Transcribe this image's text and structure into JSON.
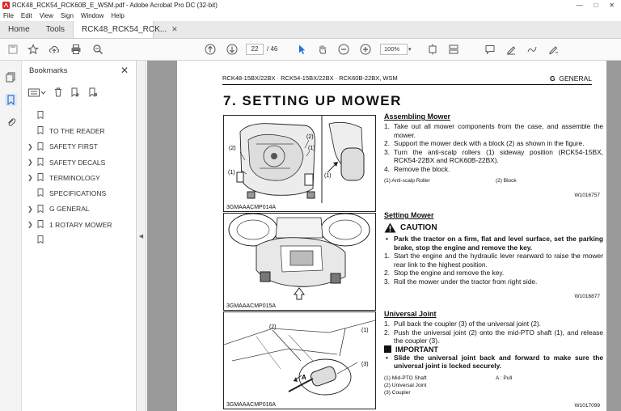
{
  "window": {
    "title": "RCK48_RCK54_RCK60B_E_WSM.pdf - Adobe Acrobat Pro DC (32-bit)"
  },
  "menu": [
    "File",
    "Edit",
    "View",
    "Sign",
    "Window",
    "Help"
  ],
  "tabs": {
    "home": "Home",
    "tools": "Tools",
    "doc": "RCK48_RCK54_RCK..."
  },
  "toolbar": {
    "page_current": "22",
    "page_total": "/ 46",
    "zoom": "100%"
  },
  "bookmarks": {
    "title": "Bookmarks",
    "items": [
      {
        "label": "",
        "expandable": false
      },
      {
        "label": "TO THE READER",
        "expandable": false
      },
      {
        "label": "SAFETY FIRST",
        "expandable": true
      },
      {
        "label": "SAFETY DECALS",
        "expandable": true
      },
      {
        "label": "TERMINOLOGY",
        "expandable": true
      },
      {
        "label": "SPECIFICATIONS",
        "expandable": false
      },
      {
        "label": "G GENERAL",
        "expandable": true
      },
      {
        "label": "1 ROTARY MOWER",
        "expandable": true
      },
      {
        "label": "",
        "expandable": false
      }
    ]
  },
  "page": {
    "header_left": "RCK48-15BX/22BX · RCK54-15BX/22BX · RCK60B-22BX, WSM",
    "header_right_g": "G",
    "header_right_text": "GENERAL",
    "heading": "7.  SETTING UP MOWER",
    "figures": {
      "fig1": {
        "caption": "3GMAAACMP014A",
        "callouts": [
          "(2)",
          "(1)",
          "(2)",
          "(1)",
          "(1)"
        ]
      },
      "fig2": {
        "caption": "3GMAAACMP015A"
      },
      "fig3": {
        "caption": "3GMAAACMP016A",
        "callouts": [
          "(2)",
          "(1)",
          "(3)",
          "A"
        ]
      }
    },
    "assembling": {
      "title": "Assembling Mower",
      "steps": [
        "Take out all mower components from the case, and assemble the mower.",
        "Support the mower deck with a block (2) as shown in the figure.",
        "Turn the anti-scalp rollers (1) sideway position (RCK54-15BX, RCK54-22BX and RCK60B-22BX).",
        "Remove the block."
      ],
      "legend1": "(1)  Anti-scalp Roller",
      "legend2": "(2)  Block",
      "code": "W1016757"
    },
    "setting": {
      "title": "Setting Mower",
      "caution": "CAUTION",
      "bullet": "Park the tractor on a firm, flat and level surface, set the parking brake, stop the engine and remove the key.",
      "steps": [
        "Start the engine and the hydraulic lever rearward to raise the mower rear link to the highest position.",
        "Stop the engine and remove the key.",
        "Roll the mower under the tractor from right side."
      ],
      "code": "W1016877"
    },
    "universal": {
      "title": "Universal Joint",
      "steps": [
        "Pull back the coupler (3) of the universal joint (2).",
        "Push the universal joint (2) onto the mid-PTO shaft (1), and release the coupler (3)."
      ],
      "important": "IMPORTANT",
      "bullet": "Slide the universal joint back and forward to make sure the universal joint is locked securely.",
      "legend": [
        "(1)  Mid-PTO Shaft",
        "(2)  Universal Joint",
        "(3)  Coupler"
      ],
      "legend_a": "A :  Pull",
      "code": "W1017099"
    }
  }
}
